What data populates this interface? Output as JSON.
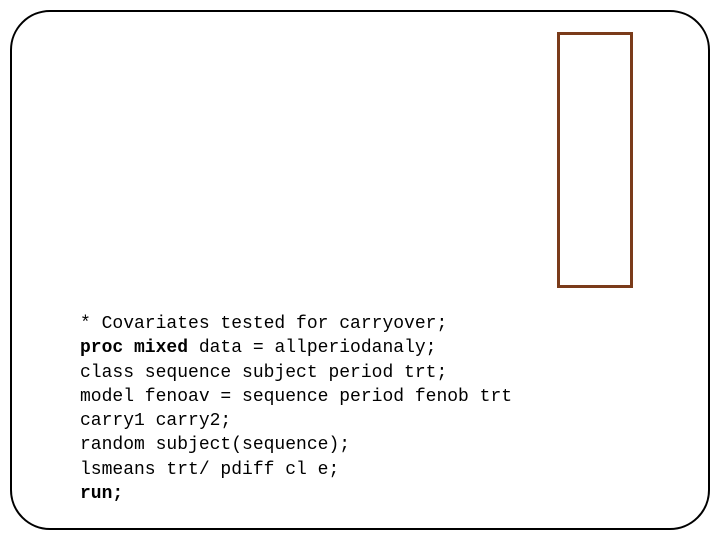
{
  "code": {
    "l1": "* Covariates tested for carryover;",
    "l2a": "proc mixed",
    "l2b": " data = allperiodanaly;",
    "l3": "class sequence subject period trt;",
    "l4": "model fenoav = sequence period fenob trt ",
    "l5": "carry1 carry2;",
    "l6": "random subject(sequence);",
    "l7": "lsmeans trt/ pdiff cl e;",
    "l8": "run;"
  }
}
